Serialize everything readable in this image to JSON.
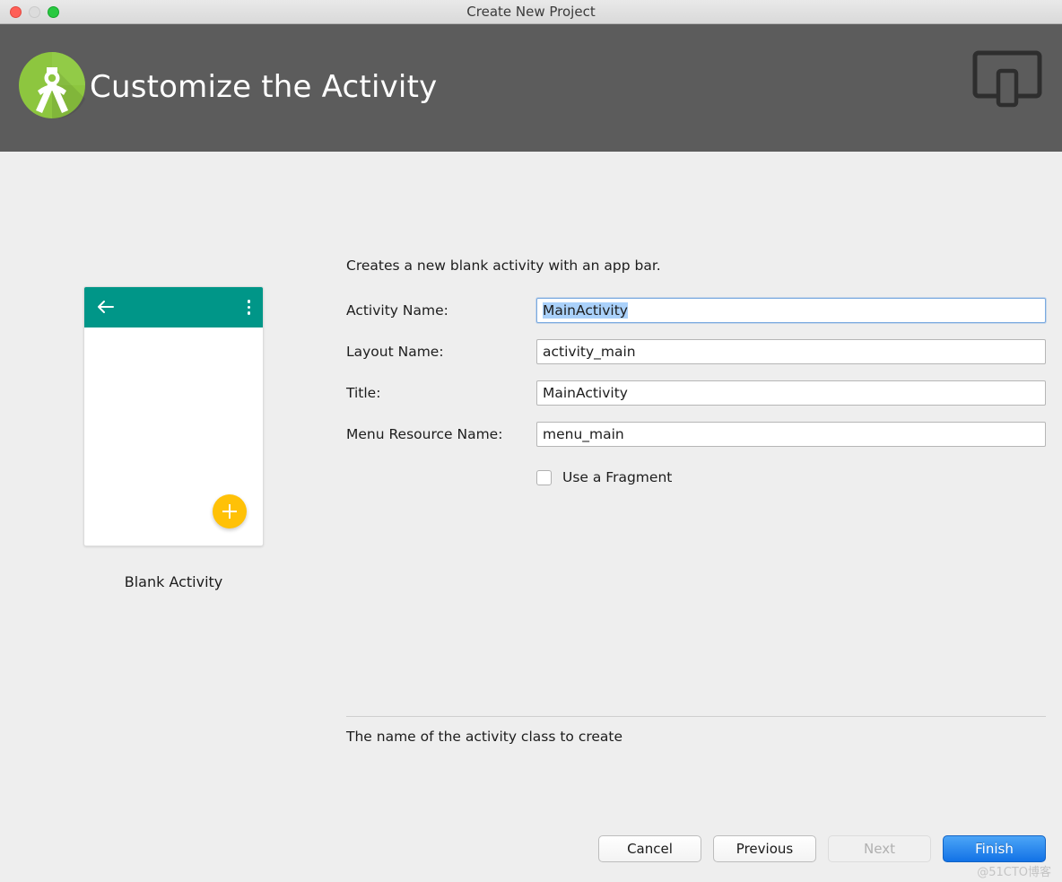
{
  "window": {
    "title": "Create New Project",
    "controls": [
      "close-button",
      "minimize-button",
      "zoom-button"
    ]
  },
  "header": {
    "title": "Customize the Activity",
    "logo_name": "android-studio-logo",
    "device_icon_name": "device-form-factor-icon",
    "background_color": "#5c5c5c"
  },
  "preview": {
    "caption": "Blank Activity",
    "appbar_color": "#009688",
    "fab_color": "#ffc107",
    "back_icon": "back-arrow-icon",
    "overflow_icon": "overflow-menu-icon",
    "fab_icon": "plus-icon"
  },
  "form": {
    "description": "Creates a new blank activity with an app bar.",
    "fields": [
      {
        "label": "Activity Name:",
        "value": "MainActivity",
        "focused": true
      },
      {
        "label": "Layout Name:",
        "value": "activity_main",
        "focused": false
      },
      {
        "label": "Title:",
        "value": "MainActivity",
        "focused": false
      },
      {
        "label": "Menu Resource Name:",
        "value": "menu_main",
        "focused": false
      }
    ],
    "checkbox": {
      "label": "Use a Fragment",
      "checked": false
    }
  },
  "hint": "The name of the activity class to create",
  "buttons": [
    {
      "label": "Cancel",
      "state": "enabled"
    },
    {
      "label": "Previous",
      "state": "enabled"
    },
    {
      "label": "Next",
      "state": "disabled"
    },
    {
      "label": "Finish",
      "state": "primary"
    }
  ],
  "watermark": "@51CTO博客",
  "colors": {
    "accent": "#1272e6",
    "teal": "#009688",
    "amber": "#ffc107",
    "header_grey": "#5c5c5c",
    "focus_border": "#7aaae0",
    "selection": "#aad1fa"
  }
}
